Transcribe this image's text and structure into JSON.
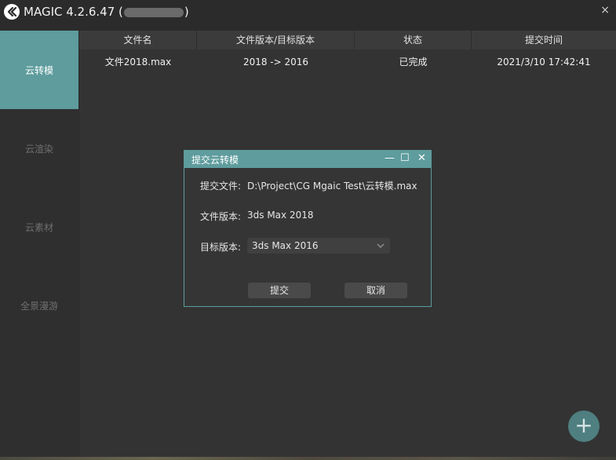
{
  "app": {
    "title_prefix": "MAGIC 4.2.6.47 (",
    "title_suffix": ")",
    "close_label": "×"
  },
  "sidebar": {
    "items": [
      {
        "label": "云转模",
        "active": true
      },
      {
        "label": "云渲染",
        "active": false
      },
      {
        "label": "云素材",
        "active": false
      },
      {
        "label": "全景漫游",
        "active": false
      }
    ]
  },
  "table": {
    "headers": [
      "文件名",
      "文件版本/目标版本",
      "状态",
      "提交时间"
    ],
    "rows": [
      {
        "file": "文件2018.max",
        "version": "2018 -> 2016",
        "status": "已完成",
        "time": "2021/3/10 17:42:41"
      }
    ]
  },
  "dialog": {
    "title": "提交云转模",
    "minimize": "—",
    "maximize": "☐",
    "close": "✕",
    "file_label": "提交文件:",
    "file_value": "D:\\Project\\CG Mgaic Test\\云转模.max",
    "version_label": "文件版本:",
    "version_value": "3ds Max 2018",
    "target_label": "目标版本:",
    "target_value": "3ds Max 2016",
    "submit_label": "提交",
    "cancel_label": "取消"
  },
  "fab": {
    "label": "+"
  },
  "colors": {
    "accent": "#5e9c9d",
    "background": "#2b2b2b"
  }
}
